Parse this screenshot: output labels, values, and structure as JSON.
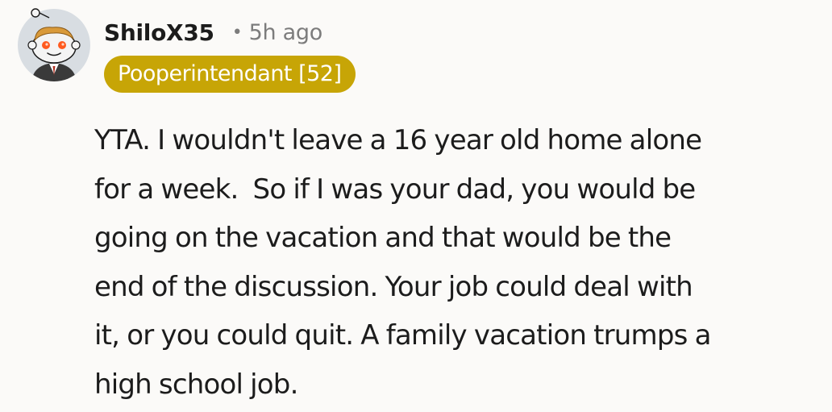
{
  "comment": {
    "username": "ShiloX35",
    "separator": "•",
    "timestamp": "5h ago",
    "flair": "Pooperintendant [52]",
    "flair_color": "#c7a506",
    "avatar_icon": "snoo-avatar-icon",
    "body_lines": [
      "YTA. I wouldn't leave a 16 year old home alone",
      "for a week.  So if I was your dad, you would be",
      "going on the vacation and that would be the",
      "end of the discussion. Your job could deal with",
      "it, or you could quit. A family vacation trumps a",
      "high school job."
    ]
  }
}
